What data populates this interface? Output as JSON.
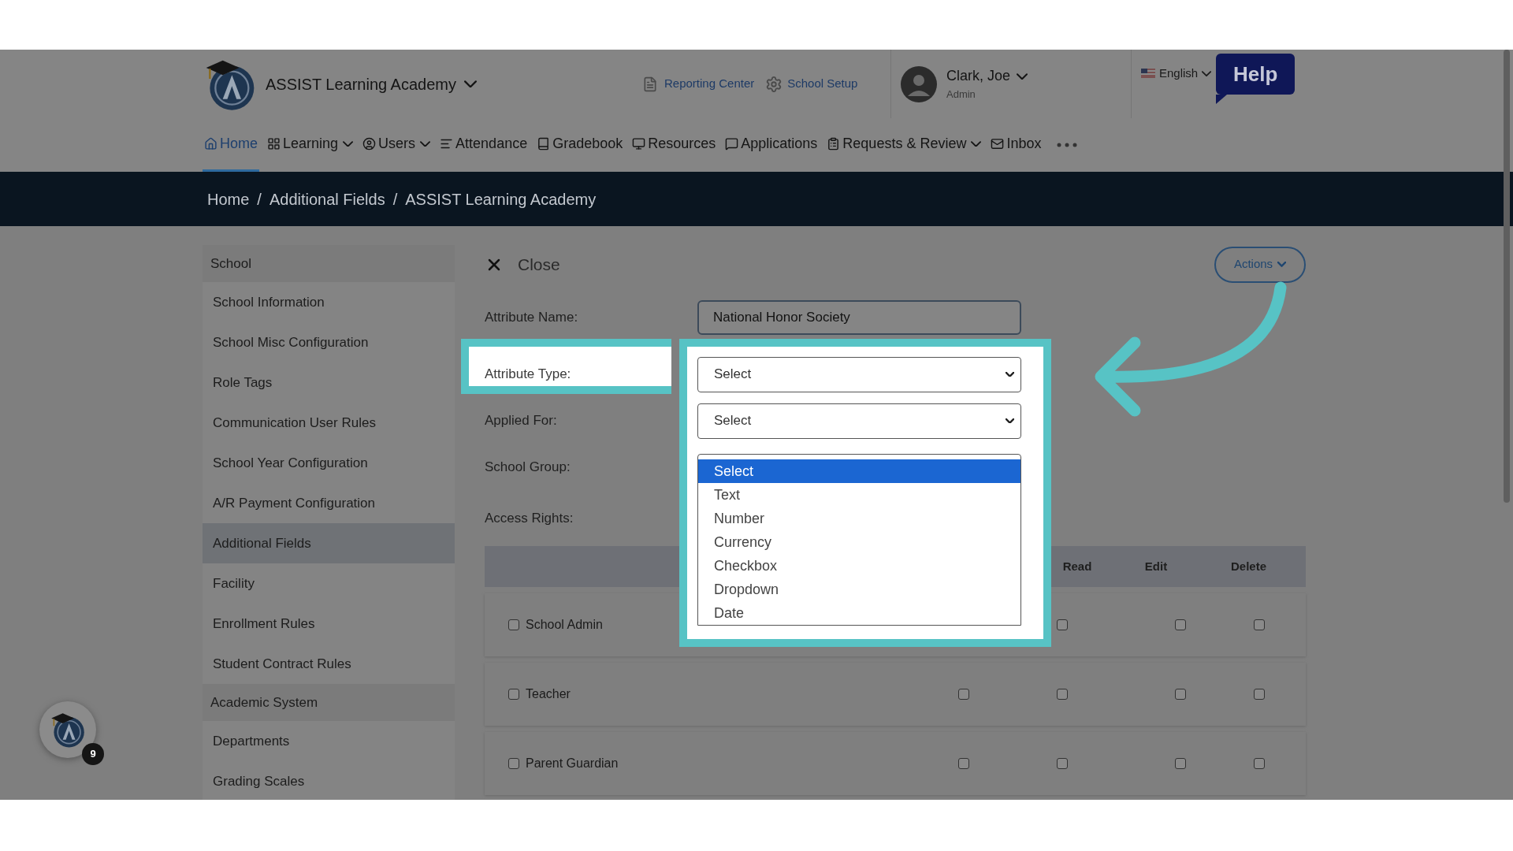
{
  "header": {
    "school_name": "ASSIST Learning Academy",
    "links": [
      "Reporting Center",
      "School Setup"
    ],
    "user": {
      "name": "Clark, Joe",
      "role": "Admin"
    },
    "language": "English",
    "help": "Help"
  },
  "nav": [
    {
      "label": "Home",
      "selected": true,
      "caret": false
    },
    {
      "label": "Learning",
      "selected": false,
      "caret": true
    },
    {
      "label": "Users",
      "selected": false,
      "caret": true
    },
    {
      "label": "Attendance",
      "selected": false,
      "caret": false
    },
    {
      "label": "Gradebook",
      "selected": false,
      "caret": false
    },
    {
      "label": "Resources",
      "selected": false,
      "caret": false
    },
    {
      "label": "Applications",
      "selected": false,
      "caret": false
    },
    {
      "label": "Requests & Review",
      "selected": false,
      "caret": true
    },
    {
      "label": "Inbox",
      "selected": false,
      "caret": false
    }
  ],
  "breadcrumb": {
    "items": [
      "Home",
      "Additional Fields",
      "ASSIST Learning Academy"
    ],
    "separator": "/"
  },
  "sidebar": [
    {
      "label": "School",
      "kind": "header"
    },
    {
      "label": "School Information",
      "kind": "item",
      "selected": false
    },
    {
      "label": "School Misc Configuration",
      "kind": "item",
      "selected": false
    },
    {
      "label": "Role Tags",
      "kind": "item",
      "selected": false
    },
    {
      "label": "Communication User Rules",
      "kind": "item",
      "selected": false
    },
    {
      "label": "School Year Configuration",
      "kind": "item",
      "selected": false
    },
    {
      "label": "A/R Payment Configuration",
      "kind": "item",
      "selected": false
    },
    {
      "label": "Additional Fields",
      "kind": "item",
      "selected": true
    },
    {
      "label": "Facility",
      "kind": "item",
      "selected": false
    },
    {
      "label": "Enrollment Rules",
      "kind": "item",
      "selected": false
    },
    {
      "label": "Student Contract Rules",
      "kind": "item",
      "selected": false
    },
    {
      "label": "Academic System",
      "kind": "header"
    },
    {
      "label": "Departments",
      "kind": "item",
      "selected": false
    },
    {
      "label": "Grading Scales",
      "kind": "item",
      "selected": false
    }
  ],
  "form": {
    "close": "Close",
    "actions": "Actions",
    "fields": [
      {
        "label": "Attribute Name:",
        "kind": "input",
        "value": "National Honor Society"
      },
      {
        "label": "Attribute Type:",
        "kind": "select",
        "value": "Select",
        "highlighted": true
      },
      {
        "label": "Applied For:",
        "kind": "select",
        "value": "Select",
        "highlighted": false
      },
      {
        "label": "School Group:",
        "kind": "listbox",
        "highlighted": false
      },
      {
        "label": "Access Rights:",
        "kind": "label",
        "highlighted": false
      }
    ],
    "options": [
      {
        "label": "Select",
        "selected": true
      },
      {
        "label": "Text",
        "selected": false
      },
      {
        "label": "Number",
        "selected": false
      },
      {
        "label": "Currency",
        "selected": false
      },
      {
        "label": "Checkbox",
        "selected": false
      },
      {
        "label": "Dropdown",
        "selected": false
      },
      {
        "label": "Date",
        "selected": false
      }
    ]
  },
  "table": {
    "columns": [
      "Read",
      "Edit",
      "Delete"
    ],
    "rows": [
      {
        "label": "School Admin",
        "checked": false,
        "rights": [
          false,
          false,
          false
        ]
      },
      {
        "label": "Teacher",
        "checked": false,
        "rights": [
          false,
          false,
          false,
          false
        ]
      },
      {
        "label": "Parent Guardian",
        "checked": false,
        "rights": [
          false,
          false,
          false,
          false
        ]
      }
    ]
  },
  "badge": "9"
}
